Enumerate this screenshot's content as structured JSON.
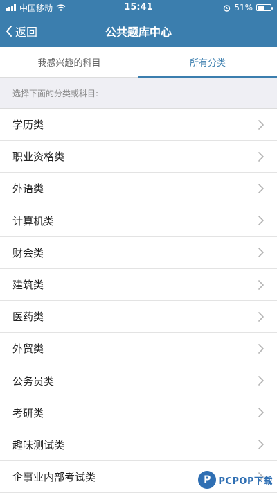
{
  "status_bar": {
    "carrier": "中国移动",
    "time": "15:41",
    "battery_percent": "51%",
    "battery_level": 0.51
  },
  "nav": {
    "back_label": "返回",
    "title": "公共题库中心"
  },
  "tabs": [
    {
      "label": "我感兴趣的科目",
      "active": false
    },
    {
      "label": "所有分类",
      "active": true
    }
  ],
  "section_hint": "选择下面的分类或科目:",
  "categories": [
    {
      "label": "学历类"
    },
    {
      "label": "职业资格类"
    },
    {
      "label": "外语类"
    },
    {
      "label": "计算机类"
    },
    {
      "label": "财会类"
    },
    {
      "label": "建筑类"
    },
    {
      "label": "医药类"
    },
    {
      "label": "外贸类"
    },
    {
      "label": "公务员类"
    },
    {
      "label": "考研类"
    },
    {
      "label": "趣味测试类"
    },
    {
      "label": "企事业内部考试类"
    }
  ],
  "watermark": {
    "text": "PCPOP下载"
  },
  "icons": {
    "signal": "signal-bars-icon",
    "wifi": "wifi-icon",
    "alarm": "alarm-icon",
    "battery": "battery-icon",
    "back": "chevron-left-icon",
    "row": "chevron-right-icon"
  }
}
